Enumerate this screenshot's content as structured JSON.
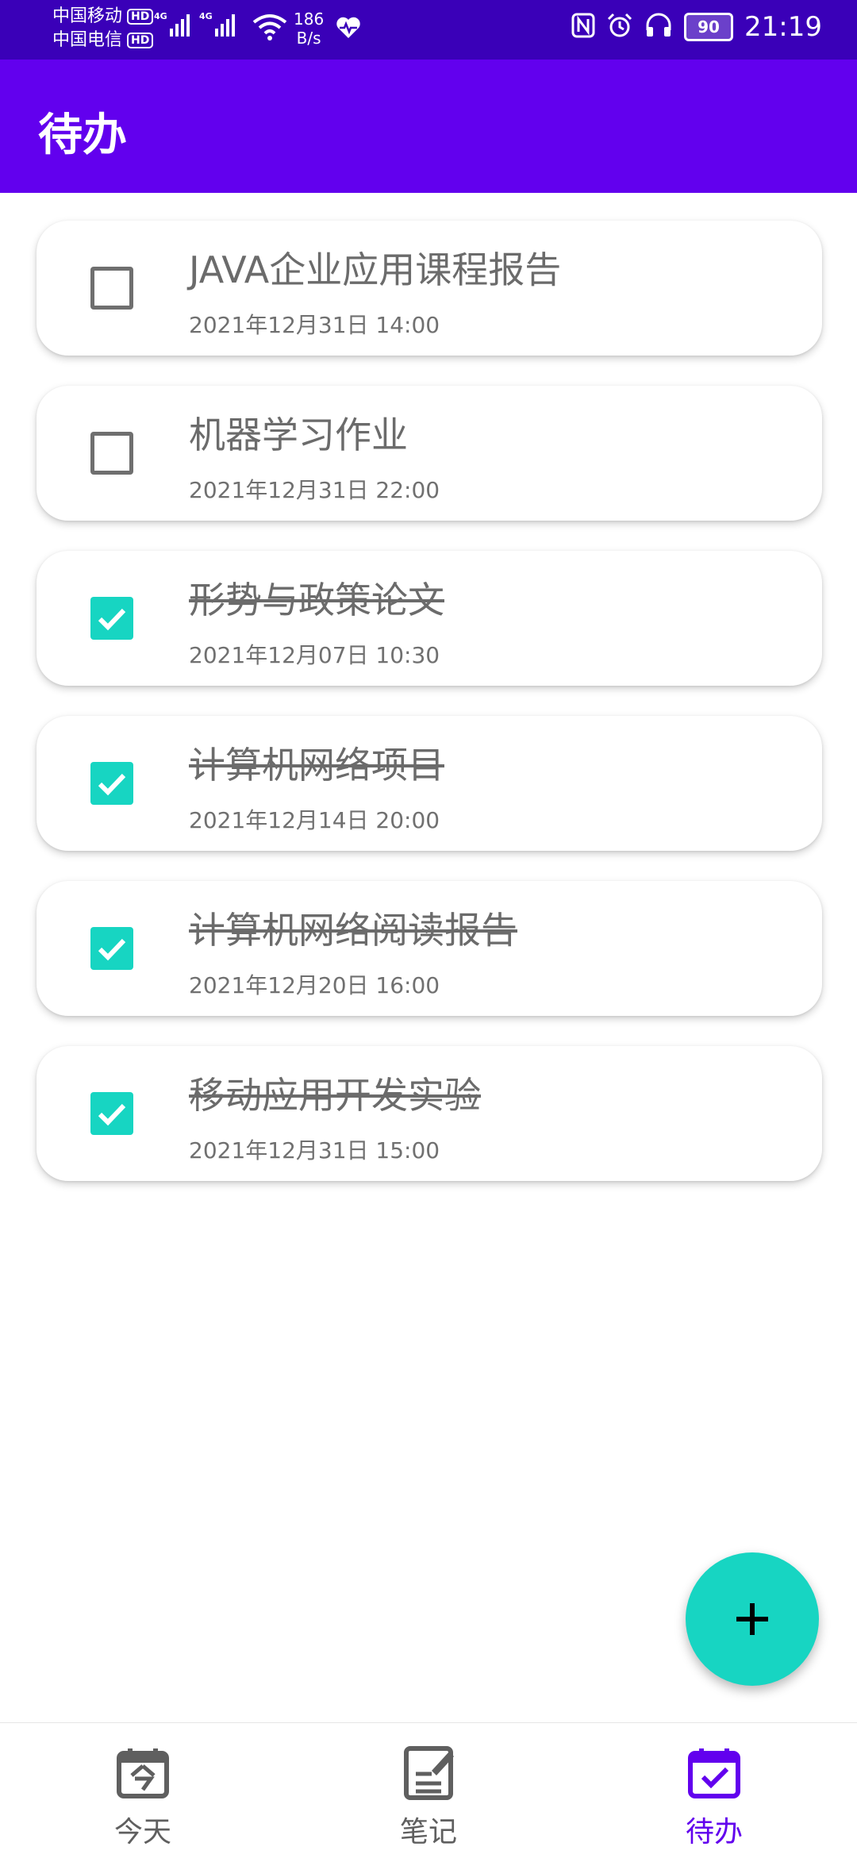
{
  "status_bar": {
    "carrier1": "中国移动",
    "carrier2": "中国电信",
    "hd": "HD",
    "net1": "4G",
    "net2": "4G",
    "speed_value": "186",
    "speed_unit": "B/s",
    "battery": "90",
    "time": "21:19"
  },
  "app_bar": {
    "title": "待办"
  },
  "todos": [
    {
      "title": "JAVA企业应用课程报告",
      "time": "2021年12月31日 14:00",
      "done": false
    },
    {
      "title": "机器学习作业",
      "time": "2021年12月31日 22:00",
      "done": false
    },
    {
      "title": "形势与政策论文",
      "time": "2021年12月07日 10:30",
      "done": true
    },
    {
      "title": "计算机网络项目",
      "time": "2021年12月14日 20:00",
      "done": true
    },
    {
      "title": "计算机网络阅读报告",
      "time": "2021年12月20日 16:00",
      "done": true
    },
    {
      "title": "移动应用开发实验",
      "time": "2021年12月31日 15:00",
      "done": true
    }
  ],
  "fab": {
    "icon": "plus-icon"
  },
  "bottom_nav": {
    "items": [
      {
        "label": "今天",
        "icon": "calendar-today-icon",
        "active": false
      },
      {
        "label": "笔记",
        "icon": "note-edit-icon",
        "active": false
      },
      {
        "label": "待办",
        "icon": "calendar-check-icon",
        "active": true
      }
    ]
  },
  "colors": {
    "status_bar": "#3a00b8",
    "primary": "#6200ee",
    "accent": "#17d5c2"
  }
}
